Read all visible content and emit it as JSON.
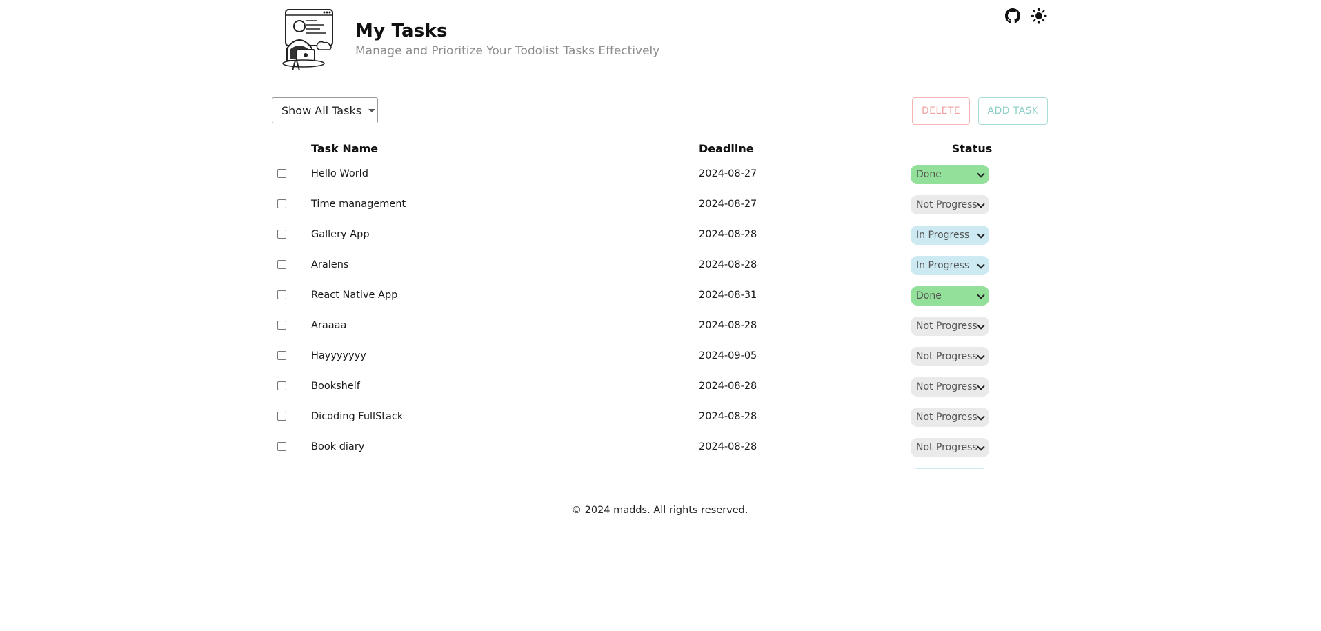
{
  "header": {
    "title": "My Tasks",
    "subtitle": "Manage and Prioritize Your Todolist Tasks Effectively",
    "icons": [
      "github-icon",
      "sun-icon"
    ]
  },
  "toolbar": {
    "filter_value": "Show All Tasks",
    "delete_label": "DELETE",
    "add_label": "ADD TASK"
  },
  "table": {
    "columns": [
      "Task Name",
      "Deadline",
      "Status"
    ],
    "rows": [
      {
        "name": "Hello World",
        "deadline": "2024-08-27",
        "status": "Done"
      },
      {
        "name": "Time management",
        "deadline": "2024-08-27",
        "status": "Not Progress"
      },
      {
        "name": "Gallery App",
        "deadline": "2024-08-28",
        "status": "In Progress"
      },
      {
        "name": "Aralens",
        "deadline": "2024-08-28",
        "status": "In Progress"
      },
      {
        "name": "React Native App",
        "deadline": "2024-08-31",
        "status": "Done"
      },
      {
        "name": "Araaaa",
        "deadline": "2024-08-28",
        "status": "Not Progress"
      },
      {
        "name": "Hayyyyyyy",
        "deadline": "2024-09-05",
        "status": "Not Progress"
      },
      {
        "name": "Bookshelf",
        "deadline": "2024-08-28",
        "status": "Not Progress"
      },
      {
        "name": "Dicoding FullStack",
        "deadline": "2024-08-28",
        "status": "Not Progress"
      },
      {
        "name": "Book diary",
        "deadline": "2024-08-28",
        "status": "Not Progress"
      }
    ]
  },
  "status_colors": {
    "Done": "#93e09b",
    "In Progress": "#cdeaf3",
    "Not Progress": "#eaeaea"
  },
  "footer": {
    "text": "© 2024 madds. All rights reserved."
  }
}
